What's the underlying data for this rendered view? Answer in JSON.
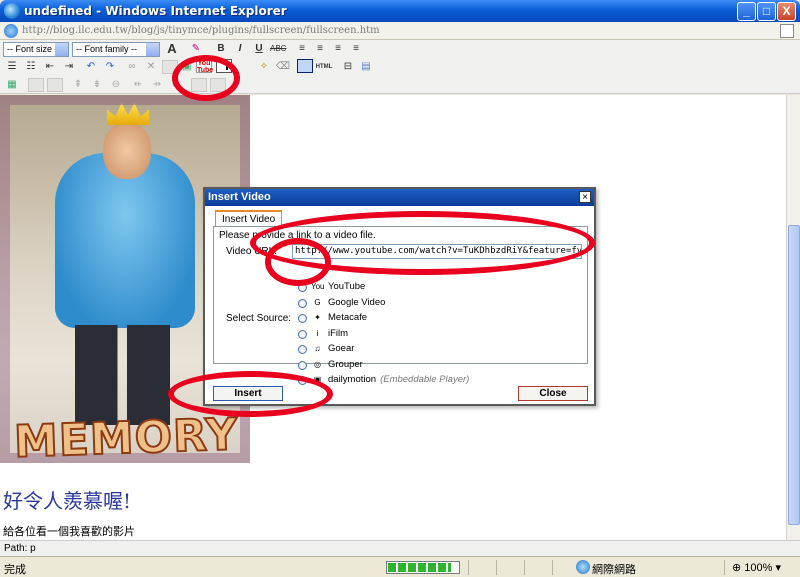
{
  "window": {
    "title": "undefined - Windows Internet Explorer",
    "minimize": "_",
    "maximize": "□",
    "close": "X"
  },
  "address": {
    "url": "http://blog.ilc.edu.tw/blog/js/tinymce/plugins/fullscreen/fullscreen.htm"
  },
  "toolbar": {
    "font_size": "-- Font size --",
    "font_family": "-- Font family --",
    "youtube_label": "You Tube",
    "html_label": "HTML",
    "row1_icons": [
      "text-color-icon",
      "highlight-color-icon",
      "bold-icon",
      "italic-icon",
      "underline-icon",
      "strikethrough-icon",
      "align-left-icon",
      "align-center-icon",
      "align-right-icon",
      "align-justify-icon"
    ],
    "row2_icons": [
      "bullet-list-icon",
      "numbered-list-icon",
      "outdent-icon",
      "indent-icon",
      "undo-icon",
      "redo-icon",
      "link-icon",
      "unlink-icon",
      "image-icon",
      "youtube-icon",
      "insert-video-icon",
      "cleanup-icon",
      "remove-format-icon",
      "fullscreen-icon",
      "html-icon",
      "horizontal-rule-icon",
      "media-icon"
    ]
  },
  "editor": {
    "photo_text": "MEMORY",
    "heading": "好令人羨慕喔!",
    "paragraph": "給各位看一個我喜歡的影片"
  },
  "pathbar": {
    "path": "Path: p"
  },
  "status": {
    "done": "完成",
    "zone": "網際網路",
    "zoom": "100%",
    "progress": 0.9
  },
  "dialog": {
    "title": "Insert Video",
    "close": "×",
    "tab": "Insert Video",
    "prompt": "Please provide a link to a video file.",
    "video_url_label": "Video URL:",
    "video_url_value": "http://www.youtube.com/watch?v=TuKDhbzdRiY&feature=fvst",
    "select_source_label": "Select Source:",
    "sources": [
      {
        "icon": "youtube-icon",
        "glyph": "You",
        "name": "YouTube",
        "note": ""
      },
      {
        "icon": "google-video-icon",
        "glyph": "G",
        "name": "Google Video",
        "note": ""
      },
      {
        "icon": "metacafe-icon",
        "glyph": "✦",
        "name": "Metacafe",
        "note": ""
      },
      {
        "icon": "ifilm-icon",
        "glyph": "i",
        "name": "iFilm",
        "note": ""
      },
      {
        "icon": "goear-icon",
        "glyph": "♫",
        "name": "Goear",
        "note": ""
      },
      {
        "icon": "grouper-icon",
        "glyph": "◎",
        "name": "Grouper",
        "note": ""
      },
      {
        "icon": "dailymotion-icon",
        "glyph": "▣",
        "name": "dailymotion",
        "note": "(Embeddable Player)"
      }
    ],
    "insert_button": "Insert",
    "close_button": "Close"
  },
  "colors": {
    "titlebar": "#0a5fd8",
    "annotation": "#e8001e",
    "heading_text": "#2b3a9a"
  }
}
